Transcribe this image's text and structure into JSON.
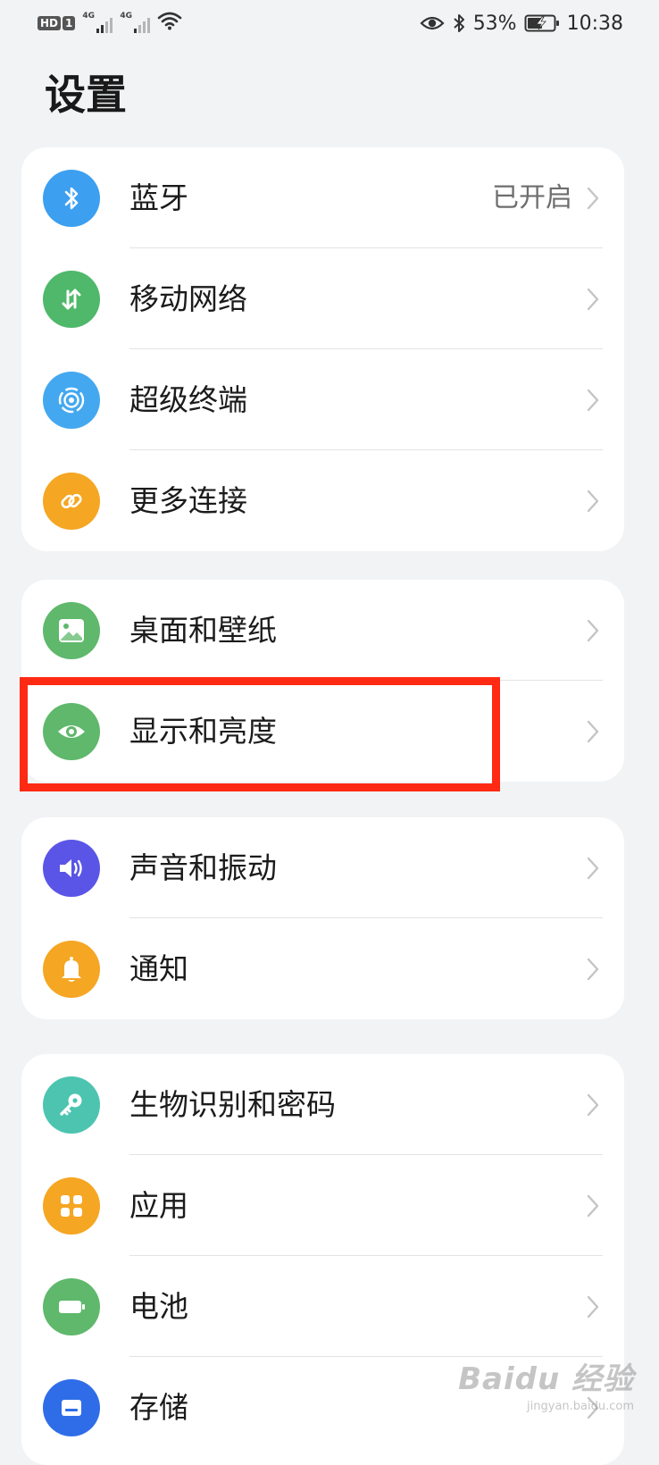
{
  "status_bar": {
    "hd_label": "HD",
    "sim_index": "1",
    "network_1": "4G",
    "network_2": "4G",
    "battery_percent": "53%",
    "time": "10:38",
    "icons": [
      "eye-comfort-icon",
      "bluetooth-icon",
      "wifi-icon",
      "battery-charging-icon"
    ]
  },
  "page": {
    "title": "设置"
  },
  "groups": [
    {
      "items": [
        {
          "label": "蓝牙",
          "value": "已开启",
          "icon": "bluetooth-icon",
          "color": "#3c9ff0"
        },
        {
          "label": "移动网络",
          "value": "",
          "icon": "mobile-data-icon",
          "color": "#4fb86a"
        },
        {
          "label": "超级终端",
          "value": "",
          "icon": "super-device-icon",
          "color": "#44a8f0"
        },
        {
          "label": "更多连接",
          "value": "",
          "icon": "link-icon",
          "color": "#f5a623"
        }
      ]
    },
    {
      "items": [
        {
          "label": "桌面和壁纸",
          "value": "",
          "icon": "wallpaper-icon",
          "color": "#5fb86b"
        },
        {
          "label": "显示和亮度",
          "value": "",
          "icon": "eye-icon",
          "color": "#5fb86b"
        }
      ]
    },
    {
      "items": [
        {
          "label": "声音和振动",
          "value": "",
          "icon": "speaker-icon",
          "color": "#5a55e6"
        },
        {
          "label": "通知",
          "value": "",
          "icon": "bell-icon",
          "color": "#f5a623"
        }
      ]
    },
    {
      "items": [
        {
          "label": "生物识别和密码",
          "value": "",
          "icon": "key-icon",
          "color": "#4cc4b0"
        },
        {
          "label": "应用",
          "value": "",
          "icon": "apps-grid-icon",
          "color": "#f5a623"
        },
        {
          "label": "电池",
          "value": "",
          "icon": "battery-icon",
          "color": "#5fb86b"
        },
        {
          "label": "存储",
          "value": "",
          "icon": "storage-icon",
          "color": "#2f6de8"
        }
      ]
    }
  ],
  "annotation": {
    "color": "#ff2a14",
    "target": "显示和亮度"
  },
  "watermark": {
    "main": "Baidu 经验",
    "sub": "jingyan.baidu.com"
  }
}
